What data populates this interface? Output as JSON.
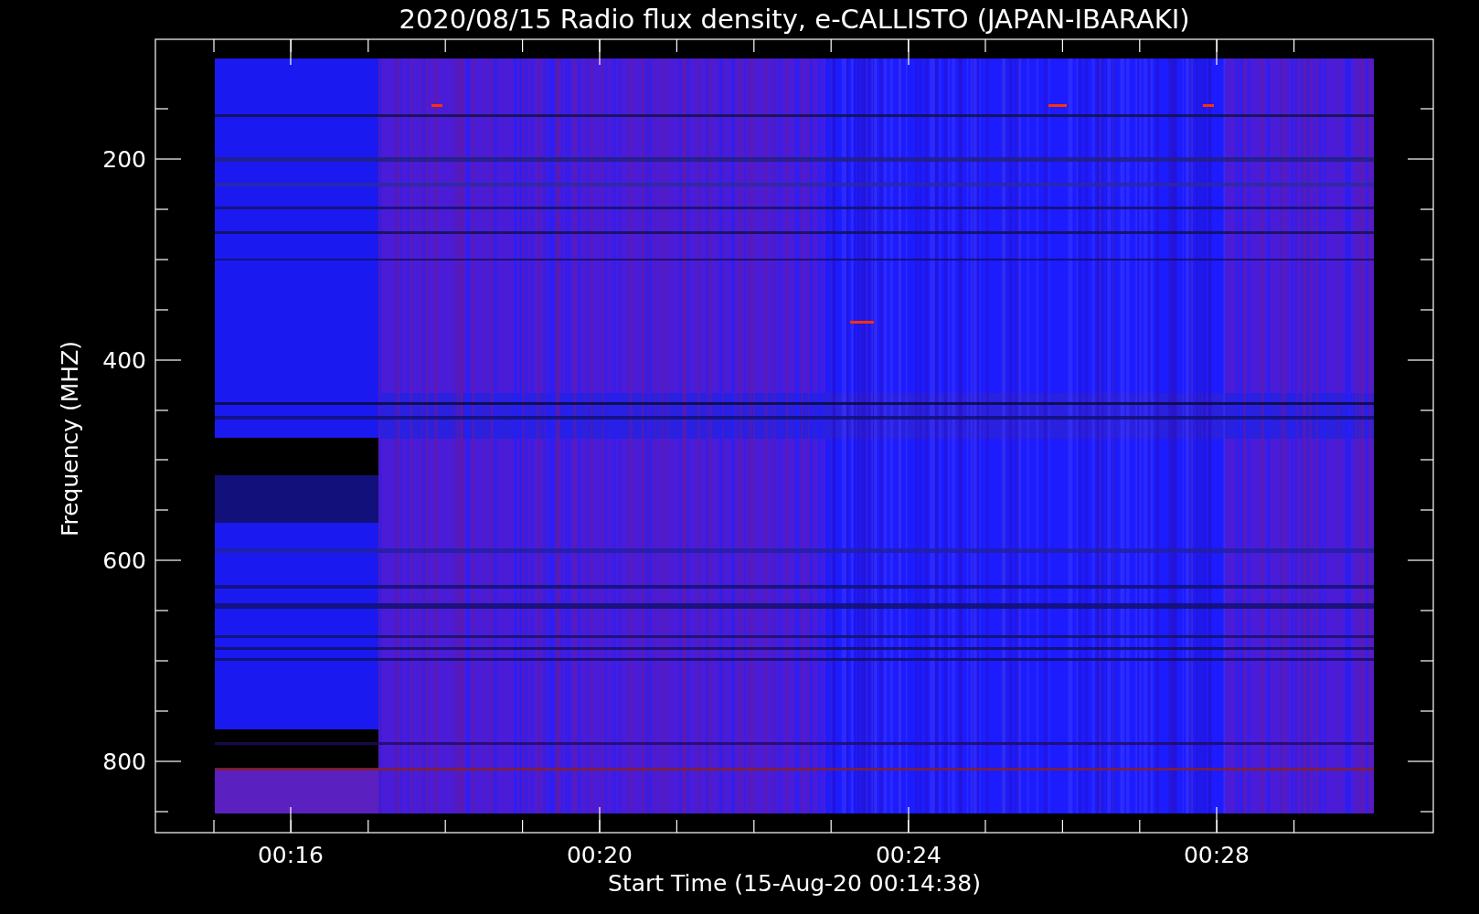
{
  "title": "2020/08/15  Radio flux density, e-CALLISTO (JAPAN-IBARAKI)",
  "y_axis": {
    "label": "Frequency (MHZ)",
    "ticks": [
      "200",
      "400",
      "600",
      "800"
    ]
  },
  "x_axis": {
    "label": "Start Time (15-Aug-20 00:14:38)",
    "ticks": [
      "00:16",
      "00:20",
      "00:24",
      "00:28"
    ]
  }
}
